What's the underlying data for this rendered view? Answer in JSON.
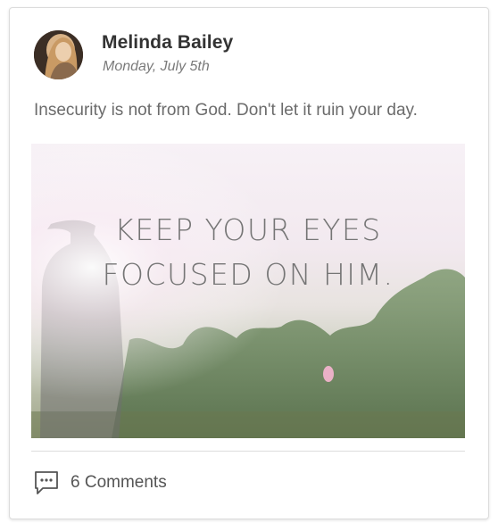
{
  "post": {
    "author": "Melinda Bailey",
    "date": "Monday, July 5th",
    "text": "Insecurity is not from God. Don't let it ruin your day.",
    "image": {
      "quote_line1": "KEEP YOUR EYES",
      "quote_line2": "FOCUSED ON HIM."
    },
    "comments_label": "6 Comments"
  },
  "icons": {
    "avatar": "profile-photo",
    "comments": "speech-bubble-icon"
  },
  "colors": {
    "author": "#333333",
    "date": "#7a7a7a",
    "body_text": "#6b6b6b",
    "quote": "#757575",
    "border": "#dcdcdc"
  }
}
